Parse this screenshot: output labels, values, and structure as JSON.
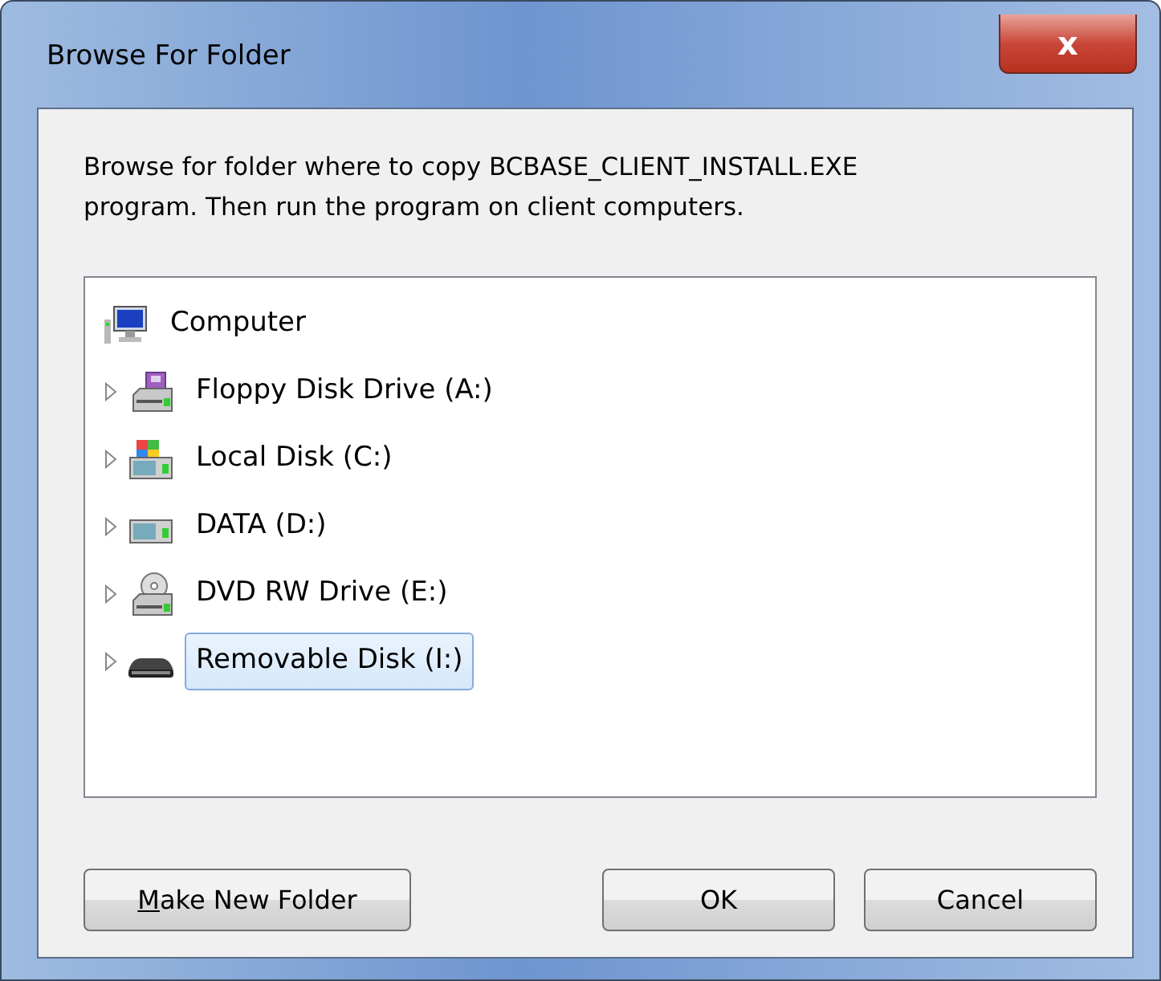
{
  "window": {
    "title": "Browse For Folder",
    "close_label": "x"
  },
  "description": "Browse for folder where to copy BCBASE_CLIENT_INSTALL.EXE program. Then run the program on client computers.",
  "tree": [
    {
      "label": "Computer",
      "kind": "computer",
      "selected": false,
      "children": [
        {
          "label": "Floppy Disk Drive (A:)",
          "kind": "floppy",
          "expanded": false,
          "selected": false
        },
        {
          "label": "Local Disk (C:)",
          "kind": "system-disk",
          "expanded": false,
          "selected": false
        },
        {
          "label": "DATA (D:)",
          "kind": "disk",
          "expanded": false,
          "selected": false
        },
        {
          "label": "DVD RW Drive (E:)",
          "kind": "dvd",
          "expanded": false,
          "selected": false
        },
        {
          "label": "Removable Disk (I:)",
          "kind": "removable",
          "expanded": false,
          "selected": true
        }
      ]
    }
  ],
  "buttons": [
    {
      "label": "Make New Folder",
      "access_key_underlined": true,
      "kind": "left"
    },
    {
      "label": "OK",
      "kind": "right"
    },
    {
      "label": "Cancel",
      "kind": "right"
    }
  ]
}
